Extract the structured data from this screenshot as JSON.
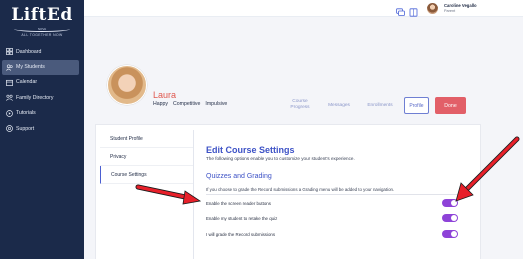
{
  "app": {
    "logo_text": "LiftEd",
    "logo_tagline": "ALL TOGETHER NOW",
    "logo_small": "NOVA"
  },
  "sidebar": {
    "items": [
      {
        "label": "Dashboard",
        "icon": "grid-icon"
      },
      {
        "label": "My Students",
        "icon": "users-icon",
        "active": true
      },
      {
        "label": "Calendar",
        "icon": "calendar-icon"
      },
      {
        "label": "Family Directory",
        "icon": "family-icon"
      },
      {
        "label": "Tutorials",
        "icon": "play-icon"
      },
      {
        "label": "Support",
        "icon": "support-icon"
      }
    ]
  },
  "topbar": {
    "user_name": "Caroline Vegallo",
    "user_role": "Parent",
    "icons": [
      "chat-icon",
      "book-icon"
    ]
  },
  "student": {
    "name": "Laura",
    "traits": [
      "Happy",
      "Competitive",
      "Impulsive"
    ]
  },
  "header_tabs": {
    "course_progress": "Course Progress",
    "messages": "Messages",
    "enrollments": "Enrollments",
    "profile": "Profile",
    "done": "Done"
  },
  "settings_nav": {
    "items": [
      "Student Profile",
      "Privacy",
      "Course Settings"
    ],
    "active_index": 2
  },
  "settings": {
    "title": "Edit Course Settings",
    "subtitle": "The following options enable you to customize your student's experience.",
    "section_title": "Quizzes and Grading",
    "section_desc": "If you choose to grade the Record submissions a Grading menu will be added to your navigation.",
    "rows": [
      {
        "label": "Enable the screen reader buttons",
        "enabled": true
      },
      {
        "label": "Enable my student to retake the quiz",
        "enabled": true
      },
      {
        "label": "I will grade the Record submissions",
        "enabled": true
      }
    ]
  },
  "colors": {
    "sidebar_bg": "#1b2a4a",
    "accent": "#3d52c6",
    "toggle_on": "#8e43d8",
    "done_button": "#e25f68",
    "student_name": "#e0584f",
    "annotation_arrow": "#e8202a"
  }
}
